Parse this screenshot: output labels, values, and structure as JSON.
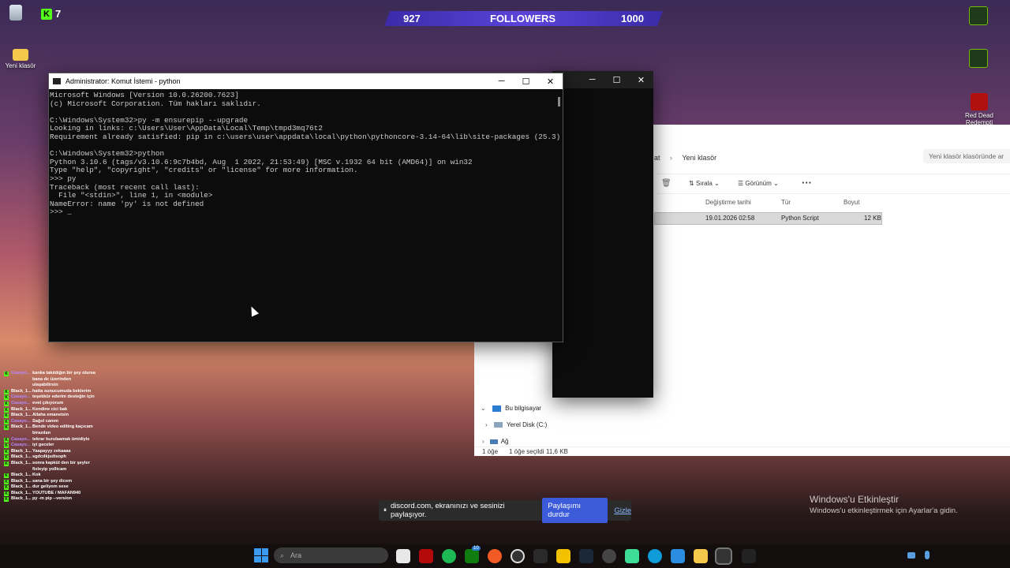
{
  "desktop": {
    "kick_count": "7",
    "icons": [
      "Yeni klasör",
      "Red Dead Redempti"
    ],
    "activate_title": "Windows'u Etkinleştir",
    "activate_sub": "Windows'u etkinleştirmek için Ayarlar'a gidin."
  },
  "followers": {
    "current": "927",
    "label": "FOLLOWERS",
    "goal": "1000"
  },
  "cmd": {
    "title": "Administrator: Komut İstemi - python",
    "lines": [
      "Microsoft Windows [Version 10.0.26200.7623]",
      "(c) Microsoft Corporation. Tüm hakları saklıdır.",
      "",
      "C:\\Windows\\System32>py -m ensurepip --upgrade",
      "Looking in links: c:\\Users\\User\\AppData\\Local\\Temp\\tmpd3mq76t2",
      "Requirement already satisfied: pip in c:\\users\\user\\appdata\\local\\python\\pythoncore-3.14-64\\lib\\site-packages (25.3)",
      "",
      "C:\\Windows\\System32>python",
      "Python 3.10.6 (tags/v3.10.6:9c7b4bd, Aug  1 2022, 21:53:49) [MSC v.1932 64 bit (AMD64)] on win32",
      "Type \"help\", \"copyright\", \"credits\" or \"license\" for more information.",
      ">>> py",
      "Traceback (most recent call last):",
      "  File \"<stdin>\", line 1, in <module>",
      "NameError: name 'py' is not defined",
      ">>> _"
    ]
  },
  "explorer": {
    "breadcrumb_prev": "at",
    "breadcrumb_current": "Yeni klasör",
    "search_placeholder": "Yeni klasör klasöründe ar",
    "toolbar": {
      "sort": "Sırala",
      "view": "Görünüm",
      "more": "···"
    },
    "columns": [
      "Değiştirme tarihi",
      "Tür",
      "Boyut"
    ],
    "row": {
      "date": "19.01.2026 02:58",
      "type": "Python Script",
      "size": "12 KB"
    },
    "nav": [
      "Bu bilgisayar",
      "Yerel Disk (C:)",
      "Ağ"
    ],
    "status": {
      "count": "1 öğe",
      "selected": "1 öğe seçildi",
      "size": "11,6 KB"
    }
  },
  "chat": [
    {
      "u": "Casayo...",
      "t": "kanka takıldığın bir şey olursa bana dc üzerinden ulaşabilirsin"
    },
    {
      "u": "Black_1...",
      "t": "hatta sunucumuda beklerim"
    },
    {
      "u": "Casayo...",
      "t": "teşekkür ederim desteğin için"
    },
    {
      "u": "Casayo...",
      "t": "evet çıkıyorum"
    },
    {
      "u": "Black_1...",
      "t": "Kendine cici bak"
    },
    {
      "u": "Black_1...",
      "t": "Allaha emanetsin"
    },
    {
      "u": "Casayo...",
      "t": "Sağol canım"
    },
    {
      "u": "Black_1...",
      "t": "Bende video editing kaçıcam birazdan"
    },
    {
      "u": "Casayo...",
      "t": "tekrar kurulaamak ümidiyle"
    },
    {
      "u": "Casayo...",
      "t": "iyi geceler"
    },
    {
      "u": "Black_1...",
      "t": "Yaapayyy zekaaaa"
    },
    {
      "u": "Black_1...",
      "t": "sgdcdkjsdtsoph"
    },
    {
      "u": "Black_1...",
      "t": "sonra kapküt den bir şeyler fixleyip yollicam"
    },
    {
      "u": "Black_1...",
      "t": "Kok"
    },
    {
      "u": "Black_1...",
      "t": "sana bir şey dicem"
    },
    {
      "u": "Black_1...",
      "t": "dur geliyom sese"
    },
    {
      "u": "Black_1...",
      "t": "YOUTUBE / MAFAN940"
    },
    {
      "u": "Black_1...",
      "t": "py -m pip --version"
    }
  ],
  "discord": {
    "text": "discord.com, ekranınızı ve sesinizi paylaşıyor.",
    "stop": "Paylaşımı durdur",
    "hide": "Gizle"
  },
  "taskbar": {
    "search_placeholder": "Ara",
    "badge": "10"
  },
  "colors": {
    "kick": "#53fc18",
    "followers": "#4b36c6",
    "discord_btn": "#3b5bdb"
  }
}
